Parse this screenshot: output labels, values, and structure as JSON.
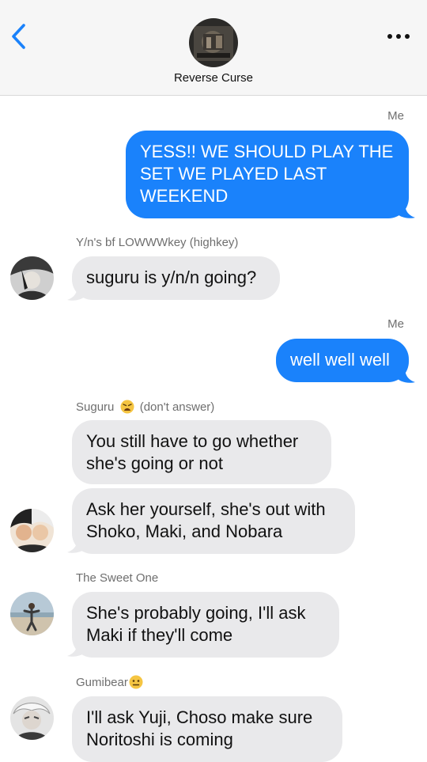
{
  "header": {
    "group_name": "Reverse Curse",
    "back_icon": "chevron-left-icon",
    "more_icon": "ellipsis-icon"
  },
  "colors": {
    "outgoing_bubble": "#1a82fb",
    "incoming_bubble": "#e9e9eb",
    "accent": "#1a82fb"
  },
  "messages": [
    {
      "sender": "Me",
      "text": "YESS!! WE SHOULD PLAY THE SET WE PLAYED LAST WEEKEND"
    },
    {
      "sender": "Y/n's bf LOWWWkey (highkey)",
      "text": "suguru is y/n/n going?"
    },
    {
      "sender": "Me",
      "text": "well well well"
    },
    {
      "sender": "Suguru",
      "sender_suffix": "(don't answer)",
      "sender_emoji": "weary-face-emoji",
      "text": "You still have to go whether she's going or not"
    },
    {
      "sender": "Suguru",
      "text": "Ask her yourself, she's out with Shoko, Maki, and Nobara"
    },
    {
      "sender": "The Sweet One",
      "text": "She's probably going, I'll ask Maki if they'll come"
    },
    {
      "sender": "Gumibear",
      "sender_emoji": "neutral-face-emoji",
      "text": "I'll ask Yuji, Choso make sure Noritoshi is coming"
    }
  ]
}
